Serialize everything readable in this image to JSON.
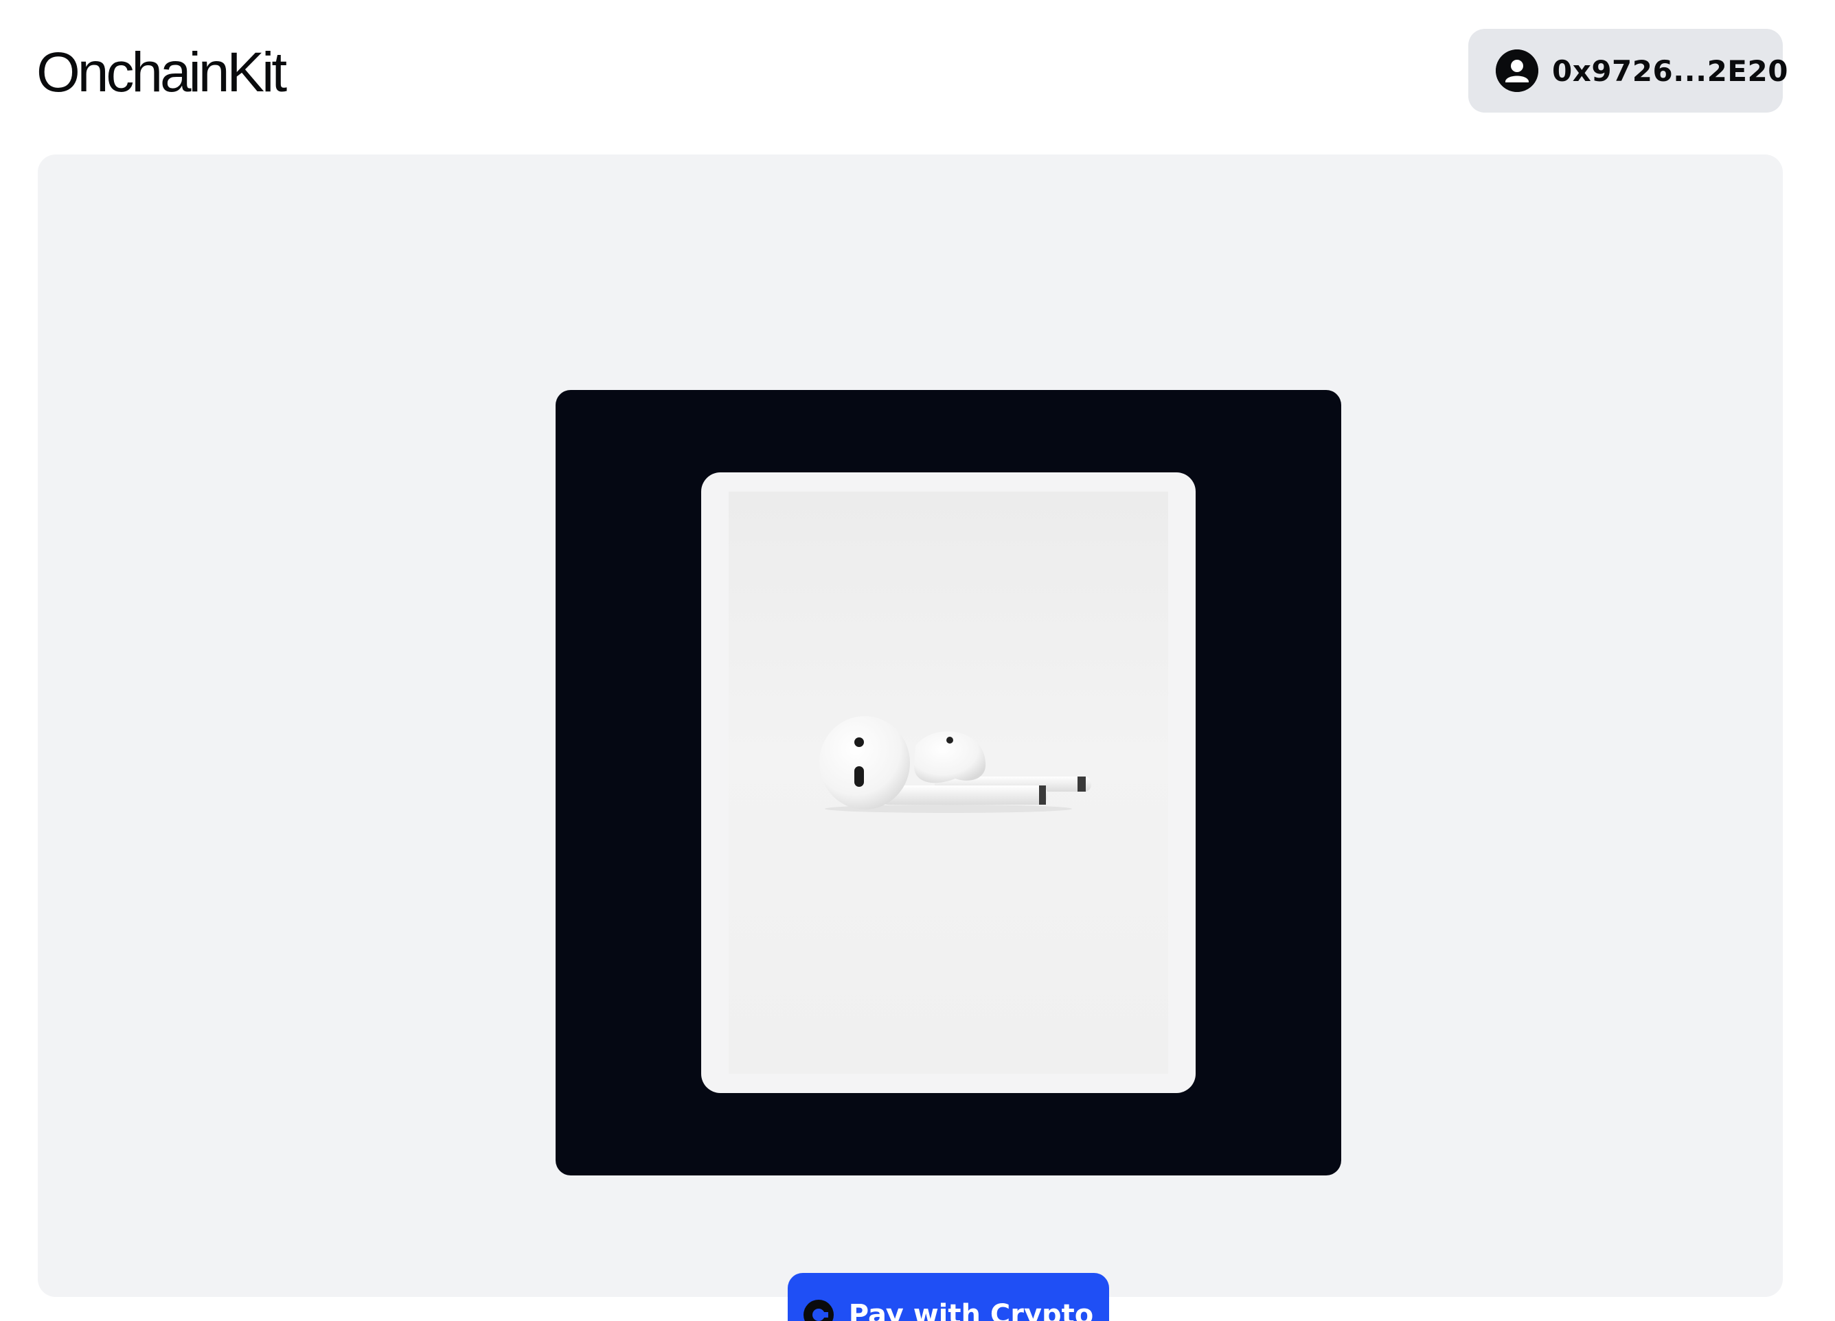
{
  "header": {
    "logo_text": "OnchainKit",
    "wallet": {
      "address": "0x9726...2E20",
      "icon": "user-avatar-icon"
    }
  },
  "product": {
    "image_subject": "white earbuds",
    "image_icon": "product-photo"
  },
  "checkout": {
    "pay_label": "Pay with Crypto",
    "pay_icon": "coinbase-logo-icon"
  },
  "colors": {
    "background": "#ffffff",
    "card_background": "#f2f3f5",
    "frame_background": "#050813",
    "wallet_button_background": "#e5e7eb",
    "pay_button_background": "#1f4ff5",
    "text_primary": "#0a0b0d"
  }
}
